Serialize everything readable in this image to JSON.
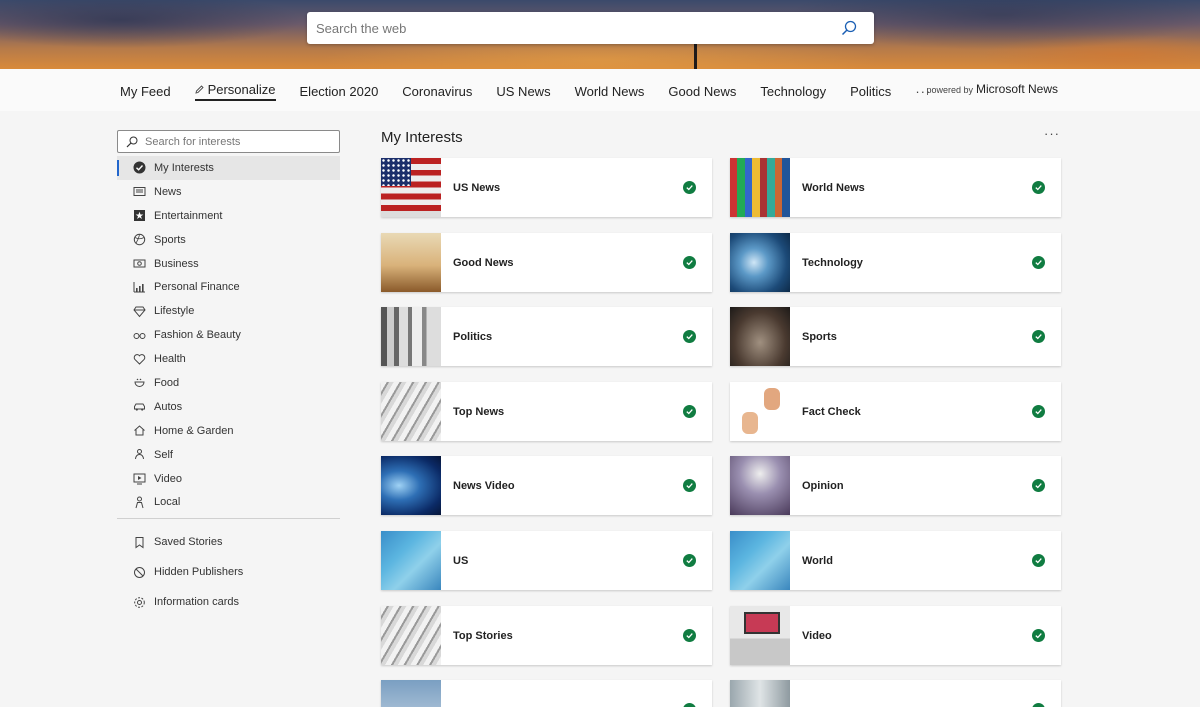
{
  "search": {
    "placeholder": "Search the web"
  },
  "nav": {
    "items": [
      {
        "label": "My Feed",
        "name": "tab-my-feed"
      },
      {
        "label": "Personalize",
        "name": "tab-personalize",
        "active": true
      },
      {
        "label": "Election 2020",
        "name": "tab-election-2020"
      },
      {
        "label": "Coronavirus",
        "name": "tab-coronavirus"
      },
      {
        "label": "US News",
        "name": "tab-us-news"
      },
      {
        "label": "World News",
        "name": "tab-world-news"
      },
      {
        "label": "Good News",
        "name": "tab-good-news"
      },
      {
        "label": "Technology",
        "name": "tab-technology"
      },
      {
        "label": "Politics",
        "name": "tab-politics"
      }
    ],
    "more": "···",
    "powered_small": "powered by",
    "powered_brand": "Microsoft News"
  },
  "sidebar": {
    "search_placeholder": "Search for interests",
    "items": [
      {
        "label": "My Interests",
        "icon": "check-circle-icon",
        "active": true
      },
      {
        "label": "News",
        "icon": "newspaper-icon"
      },
      {
        "label": "Entertainment",
        "icon": "star-icon"
      },
      {
        "label": "Sports",
        "icon": "ball-icon"
      },
      {
        "label": "Business",
        "icon": "money-icon"
      },
      {
        "label": "Personal Finance",
        "icon": "chart-icon"
      },
      {
        "label": "Lifestyle",
        "icon": "diamond-icon"
      },
      {
        "label": "Fashion & Beauty",
        "icon": "glasses-icon"
      },
      {
        "label": "Health",
        "icon": "heart-icon"
      },
      {
        "label": "Food",
        "icon": "food-icon"
      },
      {
        "label": "Autos",
        "icon": "car-icon"
      },
      {
        "label": "Home & Garden",
        "icon": "home-icon"
      },
      {
        "label": "Self",
        "icon": "self-icon"
      },
      {
        "label": "Video",
        "icon": "video-icon"
      },
      {
        "label": "Local",
        "icon": "person-icon"
      }
    ],
    "secondary": [
      {
        "label": "Saved Stories",
        "icon": "bookmark-icon"
      },
      {
        "label": "Hidden Publishers",
        "icon": "block-icon"
      },
      {
        "label": "Information cards",
        "icon": "gear-icon"
      }
    ]
  },
  "main": {
    "title": "My Interests",
    "more": "···",
    "cards": [
      {
        "label": "US News",
        "thumb": "t-flag"
      },
      {
        "label": "World News",
        "thumb": "t-flags"
      },
      {
        "label": "Good News",
        "thumb": "t-good"
      },
      {
        "label": "Technology",
        "thumb": "t-tech"
      },
      {
        "label": "Politics",
        "thumb": "t-politics"
      },
      {
        "label": "Sports",
        "thumb": "t-sports"
      },
      {
        "label": "Top News",
        "thumb": "t-paper"
      },
      {
        "label": "Fact Check",
        "thumb": "t-fact"
      },
      {
        "label": "News Video",
        "thumb": "t-video"
      },
      {
        "label": "Opinion",
        "thumb": "t-opinion"
      },
      {
        "label": "US",
        "thumb": "t-blue"
      },
      {
        "label": "World",
        "thumb": "t-blue"
      },
      {
        "label": "Top Stories",
        "thumb": "t-paper"
      },
      {
        "label": "Video",
        "thumb": "t-room"
      },
      {
        "label": "",
        "thumb": "t-bottom1"
      },
      {
        "label": "",
        "thumb": "t-bottom2"
      }
    ]
  }
}
